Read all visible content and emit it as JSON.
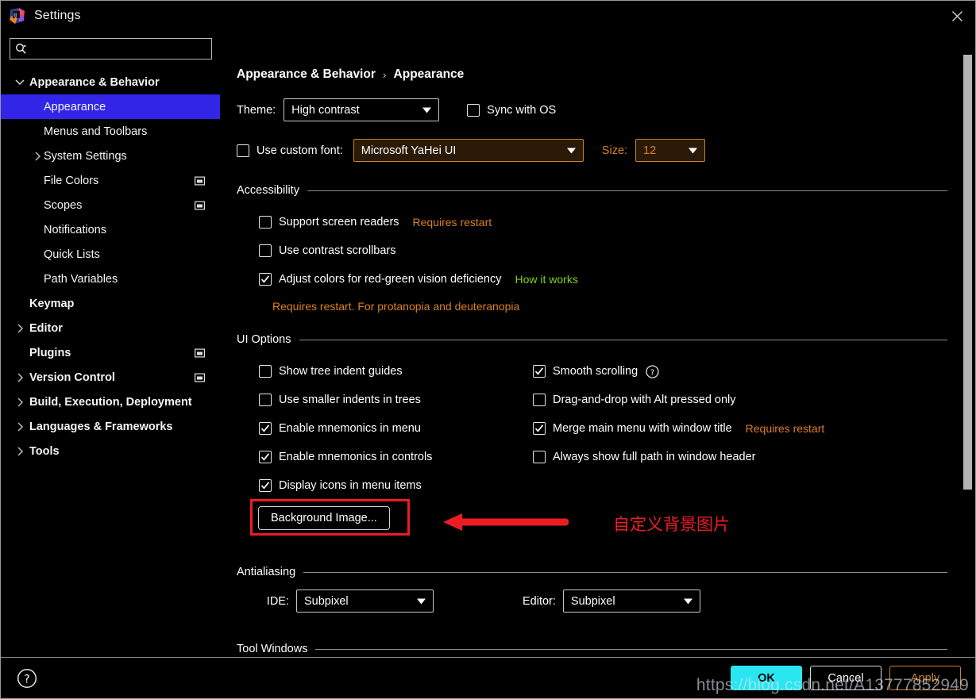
{
  "window": {
    "title": "Settings",
    "logo_icon": "intellij-idea-logo",
    "close_icon": "close-icon"
  },
  "search": {
    "icon": "search-icon",
    "value": "",
    "placeholder": ""
  },
  "sidebar": {
    "items": [
      {
        "label": "Appearance & Behavior",
        "level": 0,
        "twisty": "chevron-down-icon",
        "selected": false,
        "badge": ""
      },
      {
        "label": "Appearance",
        "level": 1,
        "twisty": "",
        "selected": true,
        "badge": ""
      },
      {
        "label": "Menus and Toolbars",
        "level": 1,
        "twisty": "",
        "selected": false,
        "badge": ""
      },
      {
        "label": "System Settings",
        "level": 1,
        "twisty": "chevron-right-icon",
        "selected": false,
        "badge": ""
      },
      {
        "label": "File Colors",
        "level": 1,
        "twisty": "",
        "selected": false,
        "badge": "project-scope-icon"
      },
      {
        "label": "Scopes",
        "level": 1,
        "twisty": "",
        "selected": false,
        "badge": "project-scope-icon"
      },
      {
        "label": "Notifications",
        "level": 1,
        "twisty": "",
        "selected": false,
        "badge": ""
      },
      {
        "label": "Quick Lists",
        "level": 1,
        "twisty": "",
        "selected": false,
        "badge": ""
      },
      {
        "label": "Path Variables",
        "level": 1,
        "twisty": "",
        "selected": false,
        "badge": ""
      },
      {
        "label": "Keymap",
        "level": 0,
        "twisty": "",
        "selected": false,
        "badge": ""
      },
      {
        "label": "Editor",
        "level": 0,
        "twisty": "chevron-right-icon",
        "selected": false,
        "badge": ""
      },
      {
        "label": "Plugins",
        "level": 0,
        "twisty": "",
        "selected": false,
        "badge": "project-scope-icon"
      },
      {
        "label": "Version Control",
        "level": 0,
        "twisty": "chevron-right-icon",
        "selected": false,
        "badge": "project-scope-icon"
      },
      {
        "label": "Build, Execution, Deployment",
        "level": 0,
        "twisty": "chevron-right-icon",
        "selected": false,
        "badge": ""
      },
      {
        "label": "Languages & Frameworks",
        "level": 0,
        "twisty": "chevron-right-icon",
        "selected": false,
        "badge": ""
      },
      {
        "label": "Tools",
        "level": 0,
        "twisty": "chevron-right-icon",
        "selected": false,
        "badge": ""
      }
    ]
  },
  "main": {
    "breadcrumb": {
      "parent": "Appearance & Behavior",
      "separator": "›",
      "current": "Appearance"
    },
    "theme_row": {
      "label": "Theme:",
      "value": "High contrast",
      "sync_label": "Sync with OS",
      "sync_checked": false
    },
    "font_row": {
      "custom_font_label": "Use custom font:",
      "custom_font_checked": false,
      "font_value": "Microsoft YaHei UI",
      "size_label": "Size:",
      "size_value": "12"
    },
    "accessibility": {
      "title": "Accessibility",
      "items": [
        {
          "label": "Support screen readers",
          "checked": false,
          "note": "Requires restart",
          "note_type": "orange"
        },
        {
          "label": "Use contrast scrollbars",
          "checked": false,
          "note": "",
          "note_type": ""
        },
        {
          "label": "Adjust colors for red-green vision deficiency",
          "checked": true,
          "note": "How it works",
          "note_type": "link"
        }
      ],
      "sub_note": "Requires restart. For protanopia and deuteranopia"
    },
    "ui_options": {
      "title": "UI Options",
      "left_column": [
        {
          "label": "Show tree indent guides",
          "checked": false
        },
        {
          "label": "Use smaller indents in trees",
          "checked": false
        },
        {
          "label": "Enable mnemonics in menu",
          "checked": true
        },
        {
          "label": "Enable mnemonics in controls",
          "checked": true
        },
        {
          "label": "Display icons in menu items",
          "checked": true
        }
      ],
      "right_column": [
        {
          "label": "Smooth scrolling",
          "checked": true,
          "help_icon": "question-circle-icon",
          "note": ""
        },
        {
          "label": "Drag-and-drop with Alt pressed only",
          "checked": false,
          "help_icon": "",
          "note": ""
        },
        {
          "label": "Merge main menu with window title",
          "checked": true,
          "help_icon": "",
          "note": "Requires restart"
        },
        {
          "label": "Always show full path in window header",
          "checked": false,
          "help_icon": "",
          "note": ""
        }
      ],
      "background_image_button": "Background Image..."
    },
    "antialiasing": {
      "title": "Antialiasing",
      "ide_label": "IDE:",
      "ide_value": "Subpixel",
      "editor_label": "Editor:",
      "editor_value": "Subpixel"
    },
    "tool_windows": {
      "title": "Tool Windows"
    }
  },
  "annotations": {
    "arrow_icon": "left-arrow-annotation",
    "highlight_box": "red-highlight-box",
    "caption": "自定义背景图片",
    "color": "#ee1d26"
  },
  "footer": {
    "help_icon": "question-circle-icon",
    "ok_label": "OK",
    "cancel_label": "Cancel",
    "apply_label": "Apply",
    "ok_color": "#28e7f0",
    "apply_color": "#c8822a"
  },
  "watermark": {
    "text": "https://blog.csdn.net/A13777852949"
  }
}
